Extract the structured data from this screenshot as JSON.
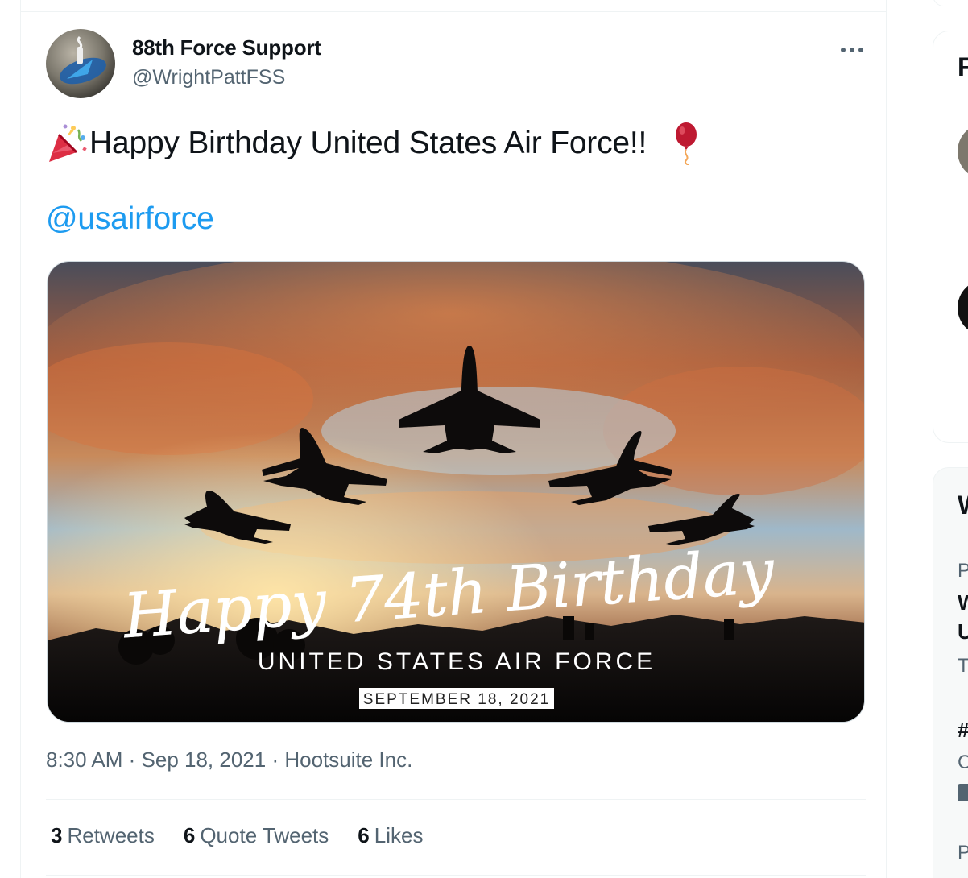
{
  "tweet": {
    "author_name": "88th Force Support",
    "author_handle": "@WrightPattFSS",
    "text": "Happy Birthday United States Air Force!!",
    "emoji_start": "party-popper-icon",
    "emoji_end": "balloon-icon",
    "mention": "@usairforce",
    "media": {
      "headline": "Happy 74th Birthday",
      "subtitle": "UNITED STATES AIR FORCE",
      "date_badge": "SEPTEMBER 18, 2021"
    },
    "time": "8:30 AM",
    "date": "Sep 18, 2021",
    "source": "Hootsuite Inc.",
    "separator": "·",
    "stats": {
      "retweets_count": "3",
      "retweets_label": "Retweets",
      "quotes_count": "6",
      "quotes_label": "Quote Tweets",
      "likes_count": "6",
      "likes_label": "Likes"
    }
  },
  "sidebar": {
    "card1_letter": "F",
    "card2_letter": "W",
    "card2_lines": [
      "P",
      "W",
      "U",
      "T",
      "#",
      "C",
      "P"
    ]
  },
  "colors": {
    "link": "#1d9bf0",
    "secondary_text": "#536471",
    "primary_text": "#0f1419"
  }
}
